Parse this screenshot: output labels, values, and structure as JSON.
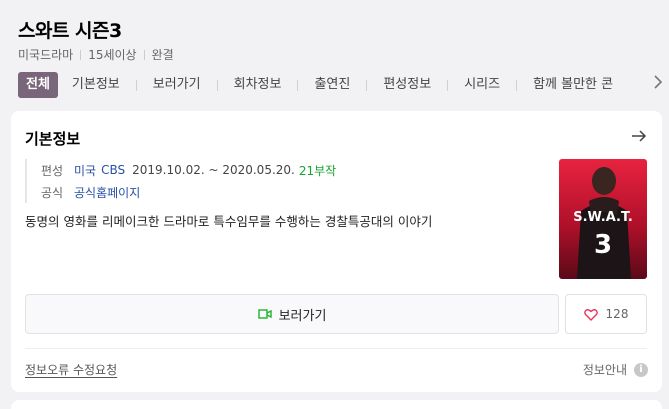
{
  "header": {
    "title": "스와트 시즌3",
    "meta": [
      "미국드라마",
      "15세이상",
      "완결"
    ]
  },
  "tabs": [
    {
      "label": "전체",
      "active": true
    },
    {
      "label": "기본정보",
      "active": false
    },
    {
      "label": "보러가기",
      "active": false
    },
    {
      "label": "회차정보",
      "active": false
    },
    {
      "label": "출연진",
      "active": false
    },
    {
      "label": "편성정보",
      "active": false
    },
    {
      "label": "시리즈",
      "active": false
    },
    {
      "label": "함께 볼만한 콘",
      "active": false
    }
  ],
  "info_card": {
    "title": "기본정보",
    "broadcast": {
      "label": "편성",
      "country": "미국",
      "channel": "CBS",
      "period": "2019.10.02. ~ 2020.05.20.",
      "episodes": "21부작"
    },
    "official": {
      "label": "공식",
      "link_text": "공식홈페이지"
    },
    "description": "동명의 영화를 리메이크한 드라마로 특수임무를 수행하는 경찰특공대의 이야기",
    "poster": {
      "text": "S.W.A.T.",
      "number": "3"
    },
    "watch_label": "보러가기",
    "like_count": "128",
    "report_label": "정보오류 수정요청",
    "guide_label": "정보안내"
  },
  "colors": {
    "active_tab": "#7a667a",
    "link_blue": "#2850a8",
    "episode_green": "#17a331",
    "poster_red": "#c8102e"
  }
}
